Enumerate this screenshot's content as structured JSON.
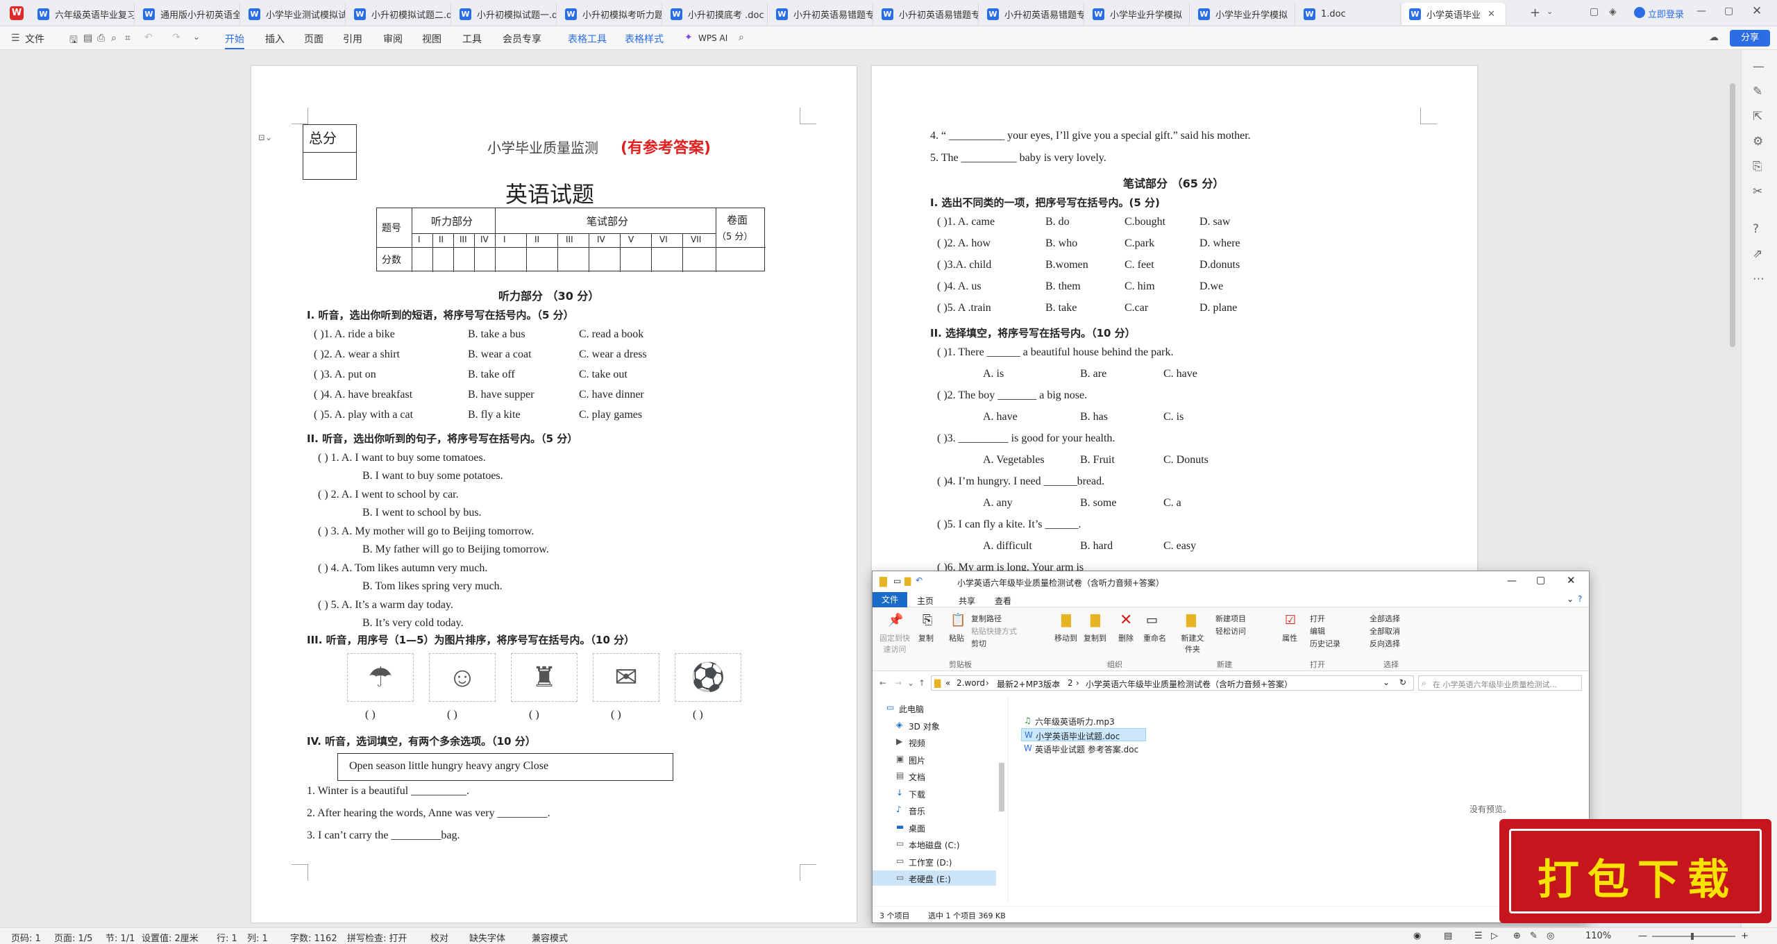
{
  "tabs": [
    {
      "label": "六年级英语毕业复习"
    },
    {
      "label": "通用版小升初英语全"
    },
    {
      "label": "小学毕业测试模拟试"
    },
    {
      "label": "小升初模拟试题二.d"
    },
    {
      "label": "小升初模拟试题一.d"
    },
    {
      "label": "小升初模拟考听力题"
    },
    {
      "label": "小升初摸底考 .doc"
    },
    {
      "label": "小升初英语易错题专"
    },
    {
      "label": "小升初英语易错题专"
    },
    {
      "label": "小升初英语易错题专"
    },
    {
      "label": "小学毕业升学模拟"
    },
    {
      "label": "小学毕业升学模拟"
    },
    {
      "label": "1.doc"
    },
    {
      "label": "小学英语毕业"
    }
  ],
  "titlebar": {
    "login": "立即登录",
    "share": "分享"
  },
  "ribbon": {
    "file": "文件",
    "menu": [
      "开始",
      "插入",
      "页面",
      "引用",
      "审阅",
      "视图",
      "工具",
      "会员专享"
    ],
    "context": [
      "表格工具",
      "表格样式"
    ],
    "ai": "WPS AI"
  },
  "page1": {
    "total_label": "总分",
    "header": "小学毕业质量监测",
    "header_red": "(有参考答案)",
    "title": "英语试题",
    "table": {
      "c_num": "题号",
      "listen": "听力部分",
      "written": "笔试部分",
      "paper": "卷面",
      "paper_pts": "（5 分）",
      "score": "分数",
      "listen_cols": [
        "I",
        "II",
        "III",
        "IV"
      ],
      "written_cols": [
        "I",
        "II",
        "III",
        "IV",
        "V",
        "VI",
        "VII"
      ]
    },
    "section_title": "听力部分 （30 分）",
    "s1_title": "I. 听音，选出你听到的短语，将序号写在括号内。（5 分）",
    "s1_items": [
      {
        "a": "(      )1. A. ride a bike",
        "b": "B. take a bus",
        "c": "C. read a book"
      },
      {
        "a": "(      )2. A. wear a shirt",
        "b": "B. wear a coat",
        "c": "C. wear a dress"
      },
      {
        "a": "(      )3. A. put on",
        "b": "B. take off",
        "c": "C. take out"
      },
      {
        "a": "(      )4. A. have breakfast",
        "b": "B. have supper",
        "c": "C. have dinner"
      },
      {
        "a": "(      )5. A. play with a cat",
        "b": "B. fly a kite",
        "c": "C. play games"
      }
    ],
    "s2_title": "II.   听音，选出你听到的句子，将序号写在括号内。（5 分）",
    "s2_items": [
      {
        "a": "(     ) 1. A. I want to buy some tomatoes.",
        "b": "B. I want to buy some potatoes."
      },
      {
        "a": "(     ) 2. A. I went to school by car.",
        "b": "B. I went to school by bus."
      },
      {
        "a": "(     ) 3. A. My mother will go to Beijing tomorrow.",
        "b": "B. My father will go to Beijing tomorrow."
      },
      {
        "a": "(     ) 4. A. Tom likes autumn very much.",
        "b": "B. Tom likes spring very much."
      },
      {
        "a": "(     ) 5. A. It’s a warm day today.",
        "b": "B. It’s very cold today."
      }
    ],
    "s3_title": "III.  听音，用序号（1—5）为图片排序，将序号写在括号内。（10 分）",
    "s3_blank": "(     )",
    "s4_title": "IV. 听音，选词填空，有两个多余选项。（10 分）",
    "s4_words": "Open    season    little     hungry    heavy    angry    Close",
    "s4_items": [
      "1.   Winter is a beautiful __________.",
      "2.   After hearing the words, Anne was very  _________.",
      "3.   I can’t carry the  _________bag."
    ]
  },
  "page2": {
    "lines": [
      "4.   “ __________   your eyes, I’ll give you a special gift.” said his mother.",
      "5.   The  __________  baby is very lovely."
    ],
    "written_title": "笔试部分 （65 分）",
    "w1_title": "I.       选出不同类的一项，把序号写在括号内。(5 分)",
    "w1_items": [
      {
        "a": "(       )1. A. came",
        "b": "B. do",
        "c": "C.bought",
        "d": "D. saw"
      },
      {
        "a": "(       )2. A. how",
        "b": "B. who",
        "c": "C.park",
        "d": "D. where"
      },
      {
        "a": "(       )3.A. child",
        "b": "B.women",
        "c": "C. feet",
        "d": "D.donuts"
      },
      {
        "a": "(       )4. A. us",
        "b": "B. them",
        "c": "C. him",
        "d": "D.we"
      },
      {
        "a": "(       )5. A .train",
        "b": "B. take",
        "c": "C.car",
        "d": "D. plane"
      }
    ],
    "w2_title": "II.   选择填空，将序号写在括号内。（10 分）",
    "w2_items": [
      {
        "q": "(       )1. There ______ a beautiful house behind the park.",
        "a": "A. is",
        "b": "B. are",
        "c": "C. have"
      },
      {
        "q": "(       )2. The boy _______ a big nose.",
        "a": "A. have",
        "b": "B. has",
        "c": "C. is"
      },
      {
        "q": "(       )3. _________ is good for your health.",
        "a": "A. Vegetables",
        "b": "B. Fruit",
        "c": "C. Donuts"
      },
      {
        "q": "(       )4. I’m hungry. I need ______bread.",
        "a": "A. any",
        "b": "B. some",
        "c": "C. a"
      },
      {
        "q": "(       )5. I can fly a kite. It’s ______.",
        "a": "A. difficult",
        "b": "B. hard",
        "c": "C. easy"
      }
    ],
    "cut_line": "(       )6. My arm is long. Your arm is"
  },
  "explorer": {
    "title": "小学英语六年级毕业质量检测试卷（含听力音频+答案）",
    "tabs": [
      "文件",
      "主页",
      "共享",
      "查看"
    ],
    "ribbon_items": [
      "固定到快速访问",
      "复制",
      "粘贴",
      "复制路径",
      "粘贴快捷方式",
      "剪切",
      "移动到",
      "复制到",
      "删除",
      "重命名",
      "新建文件夹",
      "新建项目",
      "轻松访问",
      "属性",
      "打开",
      "编辑",
      "历史记录",
      "全部选择",
      "全部取消",
      "反向选择"
    ],
    "groups": [
      "剪贴板",
      "组织",
      "新建",
      "打开",
      "选择"
    ],
    "path": [
      "2.word",
      "最新2+MP3版本",
      "2",
      "小学英语六年级毕业质量检测试卷（含听力音频+答案）"
    ],
    "search_placeholder": "在 小学英语六年级毕业质量检测试...",
    "nav": [
      "此电脑",
      "3D 对象",
      "视频",
      "图片",
      "文档",
      "下载",
      "音乐",
      "桌面",
      "本地磁盘 (C:)",
      "工作室 (D:)",
      "老硬盘 (E:)"
    ],
    "files": [
      "六年级英语听力.mp3",
      "小学英语毕业试题.doc",
      "英语毕业试题   参考答案.doc"
    ],
    "preview": "没有预览。",
    "status": [
      "3 个项目",
      "选中 1 个项目  369 KB"
    ]
  },
  "banner": "打包下载",
  "statusbar": {
    "items": [
      "页码: 1",
      "页面: 1/5",
      "节: 1/1",
      "设置值: 2厘米",
      "行: 1",
      "列: 1",
      "字数: 1162",
      "拼写检查: 打开",
      "校对",
      "缺失字体",
      "兼容模式"
    ],
    "zoom": "110%"
  }
}
